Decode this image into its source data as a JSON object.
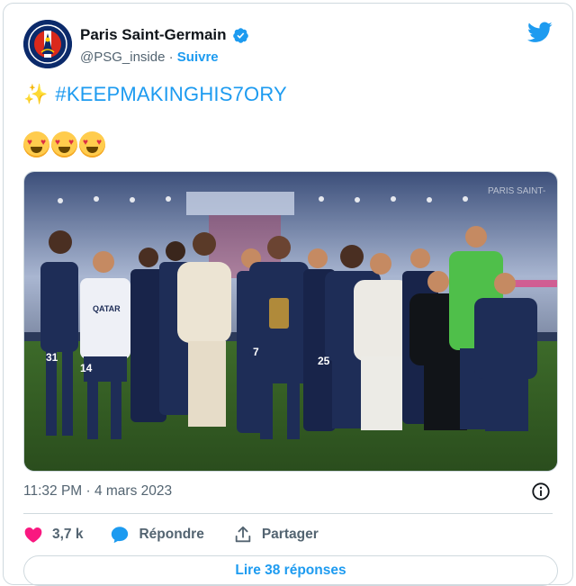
{
  "account": {
    "name": "Paris Saint-Germain",
    "handle": "@PSG_inside",
    "separator": "·",
    "follow_label": "Suivre",
    "avatar_icon": "psg-crest-icon",
    "verified_icon": "verified-badge-icon",
    "platform_icon": "twitter-bird-icon"
  },
  "tweet": {
    "sparkles": "✨",
    "hashtag": "#KEEPMAKINGHIS7ORY",
    "emojis": [
      "heart-eyes-emoji",
      "heart-eyes-emoji",
      "heart-eyes-emoji"
    ],
    "photo": {
      "stadium_banner": "PARIS SAINT-",
      "jersey_numbers": [
        "31",
        "14",
        "7",
        "25"
      ],
      "shirt_sponsor": "QATAR"
    },
    "timestamp": "11:32 PM · 4 mars 2023"
  },
  "actions": {
    "like_count": "3,7 k",
    "reply_label": "Répondre",
    "share_label": "Partager"
  },
  "replies_button": "Lire 38 réponses",
  "colors": {
    "accent": "#1d9bf0",
    "text_primary": "#0f1419",
    "text_secondary": "#536471",
    "like": "#f91880",
    "border": "#cfd9de"
  }
}
